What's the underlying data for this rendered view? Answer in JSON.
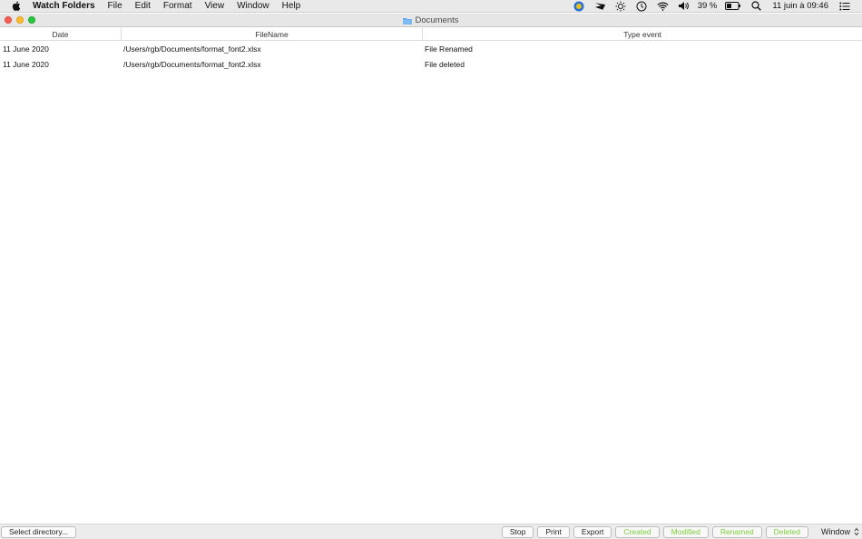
{
  "menubar": {
    "app_name": "Watch Folders",
    "items": [
      "File",
      "Edit",
      "Format",
      "View",
      "Window",
      "Help"
    ],
    "battery_percent": "39 %",
    "clock": "11 juin à 09:46"
  },
  "window": {
    "title": "Documents"
  },
  "table": {
    "columns": [
      "Date",
      "FileName",
      "Type event"
    ],
    "rows": [
      {
        "date": "11 June 2020",
        "filename": "/Users/rgb/Documents/format_font2.xlsx",
        "type": "File Renamed"
      },
      {
        "date": "11 June 2020",
        "filename": "/Users/rgb/Documents/format_font2.xlsx",
        "type": "File deleted"
      }
    ]
  },
  "bottombar": {
    "select_directory": "Select directory...",
    "stop": "Stop",
    "print": "Print",
    "export": "Export",
    "created": "Created",
    "modified": "Modified",
    "renamed": "Renamed",
    "deleted": "Deleted",
    "window_select": "Window"
  },
  "colors": {
    "filter_text": "#7fcf3c",
    "close": "#fe5f57",
    "minimize": "#febc2e",
    "zoom": "#28c840"
  }
}
